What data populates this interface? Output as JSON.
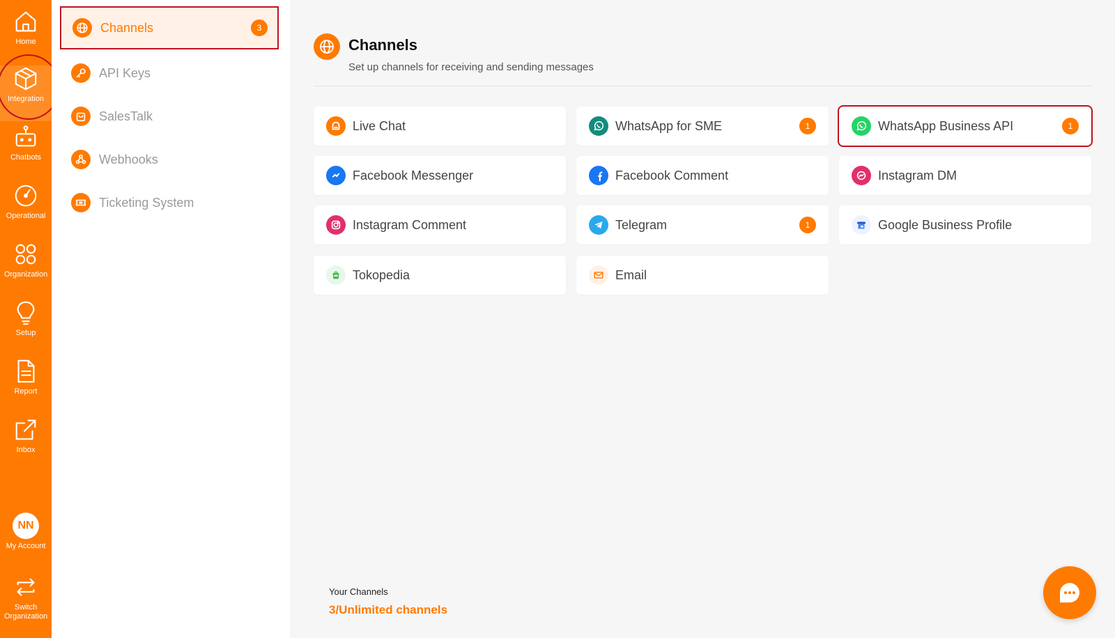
{
  "rail": {
    "items": [
      {
        "label": "Home",
        "icon": "home-icon"
      },
      {
        "label": "Integration",
        "icon": "cube-icon"
      },
      {
        "label": "Chatbots",
        "icon": "robot-icon"
      },
      {
        "label": "Operational",
        "icon": "gauge-icon"
      },
      {
        "label": "Organization",
        "icon": "grid-circles-icon"
      },
      {
        "label": "Setup",
        "icon": "bulb-icon"
      },
      {
        "label": "Report",
        "icon": "document-icon"
      },
      {
        "label": "Inbox",
        "icon": "external-link-icon"
      }
    ],
    "account": {
      "initials": "NN",
      "label": "My Account"
    },
    "switch_org": {
      "label_line1": "Switch",
      "label_line2": "Organization"
    }
  },
  "subnav": {
    "items": [
      {
        "label": "Channels",
        "icon": "globe-icon",
        "badge": "3"
      },
      {
        "label": "API Keys",
        "icon": "key-icon"
      },
      {
        "label": "SalesTalk",
        "icon": "bag-icon"
      },
      {
        "label": "Webhooks",
        "icon": "webhook-icon"
      },
      {
        "label": "Ticketing System",
        "icon": "ticket-icon"
      }
    ]
  },
  "header": {
    "title": "Channels",
    "subtitle": "Set up channels for receiving and sending messages",
    "icon": "globe-icon"
  },
  "channels": [
    {
      "label": "Live Chat",
      "icon": "livechat-icon",
      "color": "#ff7a00"
    },
    {
      "label": "WhatsApp for SME",
      "icon": "whatsapp-icon",
      "color": "#128c7e",
      "badge": "1"
    },
    {
      "label": "WhatsApp Business API",
      "icon": "whatsapp-icon",
      "color": "#25d366",
      "badge": "1"
    },
    {
      "label": "Facebook Messenger",
      "icon": "messenger-icon",
      "color": "#1877f2"
    },
    {
      "label": "Facebook Comment",
      "icon": "facebook-icon",
      "color": "#1877f2"
    },
    {
      "label": "Instagram DM",
      "icon": "instagram-dm-icon",
      "color": "#e1306c"
    },
    {
      "label": "Instagram Comment",
      "icon": "instagram-icon",
      "color": "#e1306c"
    },
    {
      "label": "Telegram",
      "icon": "telegram-icon",
      "color": "#29a9eb",
      "badge": "1"
    },
    {
      "label": "Google Business Profile",
      "icon": "google-business-icon",
      "color": "#4285f4"
    },
    {
      "label": "Tokopedia",
      "icon": "tokopedia-icon",
      "color": "#42b549"
    },
    {
      "label": "Email",
      "icon": "email-icon",
      "color": "#ff7a00"
    }
  ],
  "footer": {
    "label": "Your Channels",
    "value": "3/Unlimited channels"
  },
  "colors": {
    "accent": "#ff7a00",
    "highlight_border": "#c0121e"
  }
}
